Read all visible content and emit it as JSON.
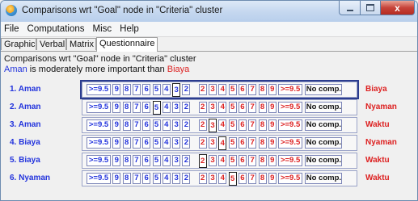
{
  "window": {
    "title": "Comparisons wrt \"Goal\" node in \"Criteria\" cluster",
    "controls": {
      "minimize": "",
      "maximize": "",
      "close": "x"
    }
  },
  "menu": [
    "File",
    "Computations",
    "Misc",
    "Help"
  ],
  "tabs": [
    {
      "label": "Graphic",
      "active": false
    },
    {
      "label": "Verbal",
      "active": false
    },
    {
      "label": "Matrix",
      "active": false
    },
    {
      "label": "Questionnaire",
      "active": true
    }
  ],
  "header": {
    "line1": "Comparisons wrt \"Goal\" node in \"Criteria\" cluster",
    "statement_left": "Aman",
    "statement_middle": " is moderately more important than ",
    "statement_right": "Biaya"
  },
  "scale": {
    "left": [
      ">=9.5",
      "9",
      "8",
      "7",
      "6",
      "5",
      "4",
      "3",
      "2"
    ],
    "right": [
      "2",
      "3",
      "4",
      "5",
      "6",
      "7",
      "8",
      "9",
      ">=9.5"
    ],
    "no_comp": "No comp."
  },
  "rows": [
    {
      "index": "1.",
      "left": "Aman",
      "right": "Biaya",
      "selected_side": "left",
      "selected_value": "3",
      "focused": true
    },
    {
      "index": "2.",
      "left": "Aman",
      "right": "Nyaman",
      "selected_side": "left",
      "selected_value": "5",
      "focused": false
    },
    {
      "index": "3.",
      "left": "Aman",
      "right": "Waktu",
      "selected_side": "right",
      "selected_value": "3",
      "focused": false
    },
    {
      "index": "4.",
      "left": "Biaya",
      "right": "Nyaman",
      "selected_side": "right",
      "selected_value": "4",
      "focused": false
    },
    {
      "index": "5.",
      "left": "Biaya",
      "right": "Waktu",
      "selected_side": "right",
      "selected_value": "2",
      "focused": false
    },
    {
      "index": "6.",
      "left": "Nyaman",
      "right": "Waktu",
      "selected_side": "right",
      "selected_value": "5",
      "focused": false
    }
  ],
  "colors": {
    "left_text": "#2233dd",
    "right_text": "#dd2222",
    "focus_frame": "#2b3c8f"
  }
}
